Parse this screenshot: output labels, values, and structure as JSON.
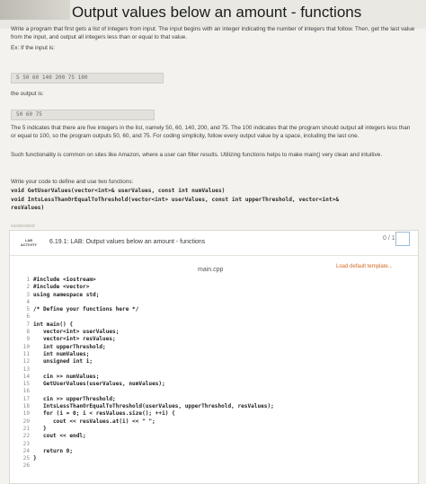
{
  "page": {
    "title": "Output values below an amount - functions"
  },
  "intro": {
    "p1": "Write a program that first gets a list of integers from input. The input begins with an integer indicating the number of integers that follow. Then, get the last value from the input, and output all integers less than or equal to that value.",
    "example_label": "Ex: If the input is:",
    "example_input": "5 50 60 140 200 75 100",
    "output_label": "the output is:",
    "example_output": "50 60 75",
    "p2": "The 5 indicates that there are five integers in the list, namely 50, 60, 140, 200, and 75. The 100 indicates that the program should output all integers less than or equal to 100, so the program outputs 50, 60, and 75. For coding simplicity, follow every output value by a space, including the last one.",
    "p3": "Such functionality is common on sites like Amazon, where a user can filter results. Utilizing functions helps to make main() very clean and intuitive.",
    "p4": "Write your code to define and use two functions:",
    "fn1": "void GetUserValues(vector<int>& userValues, const int numValues)",
    "fn2": "void IntsLessThanOrEqualToThreshold(vector<int> userValues, const int upperThreshold, vector<int>&",
    "fn2b": "resValues)",
    "faint_note": "sasdasdasd"
  },
  "lab": {
    "badge_line1": "LAB",
    "badge_line2": "ACTIVITY",
    "title": "6.19.1: LAB: Output values below an amount - functions",
    "score": "0 / 10",
    "filename": "main.cpp",
    "load_template": "Load default template..."
  },
  "code": [
    {
      "n": "1",
      "t": "#include <iostream>"
    },
    {
      "n": "2",
      "t": "#include <vector>"
    },
    {
      "n": "3",
      "t": "using namespace std;"
    },
    {
      "n": "4",
      "t": ""
    },
    {
      "n": "5",
      "t": "/* Define your functions here */"
    },
    {
      "n": "6",
      "t": ""
    },
    {
      "n": "7",
      "t": "int main() {"
    },
    {
      "n": "8",
      "t": "   vector<int> userValues;"
    },
    {
      "n": "9",
      "t": "   vector<int> resValues;"
    },
    {
      "n": "10",
      "t": "   int upperThreshold;"
    },
    {
      "n": "11",
      "t": "   int numValues;"
    },
    {
      "n": "12",
      "t": "   unsigned int i;"
    },
    {
      "n": "13",
      "t": ""
    },
    {
      "n": "14",
      "t": "   cin >> numValues;"
    },
    {
      "n": "15",
      "t": "   GetUserValues(userValues, numValues);"
    },
    {
      "n": "16",
      "t": ""
    },
    {
      "n": "17",
      "t": "   cin >> upperThreshold;"
    },
    {
      "n": "18",
      "t": "   IntsLessThanOrEqualToThreshold(userValues, upperThreshold, resValues);"
    },
    {
      "n": "19",
      "t": "   for (i = 0; i < resValues.size(); ++i) {"
    },
    {
      "n": "20",
      "t": "      cout << resValues.at(i) << \" \";"
    },
    {
      "n": "21",
      "t": "   }"
    },
    {
      "n": "22",
      "t": "   cout << endl;"
    },
    {
      "n": "23",
      "t": ""
    },
    {
      "n": "24",
      "t": "   return 0;"
    },
    {
      "n": "25",
      "t": "}"
    },
    {
      "n": "26",
      "t": ""
    }
  ]
}
